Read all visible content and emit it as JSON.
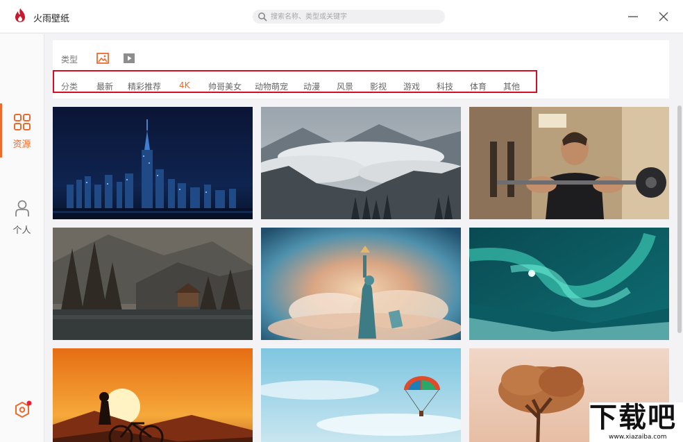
{
  "app": {
    "title": "火雨壁纸",
    "accent": "#ee6a2c",
    "highlight_border": "#d80d1f"
  },
  "search": {
    "placeholder": "搜索名称、类型或关键字",
    "value": ""
  },
  "sidebar": {
    "items": [
      {
        "label": "资源",
        "icon": "grid-icon",
        "active": true
      },
      {
        "label": "个人",
        "icon": "user-icon",
        "active": false
      }
    ],
    "settings_icon": "settings-icon"
  },
  "filter": {
    "type_label": "类型",
    "types": [
      {
        "icon": "image-icon",
        "active": true
      },
      {
        "icon": "video-icon",
        "active": false
      }
    ],
    "categories": [
      "分类",
      "最新",
      "精彩推荐",
      "4K",
      "帅哥美女",
      "动物萌宠",
      "动漫",
      "风景",
      "影视",
      "游戏",
      "科技",
      "体育",
      "其他"
    ],
    "active_category": "4K"
  },
  "wallpapers": [
    {
      "subject": "night-city-skyline"
    },
    {
      "subject": "misty-mountains"
    },
    {
      "subject": "man-lifting-barbell"
    },
    {
      "subject": "lake-cabin-autumn"
    },
    {
      "subject": "statue-of-liberty"
    },
    {
      "subject": "aurora-borealis"
    },
    {
      "subject": "sunset-bicycle-silhouette"
    },
    {
      "subject": "paraglider-sky"
    },
    {
      "subject": "lone-tree"
    }
  ],
  "watermark": {
    "big": "下载吧",
    "small": "www.xiazaiba.com"
  }
}
